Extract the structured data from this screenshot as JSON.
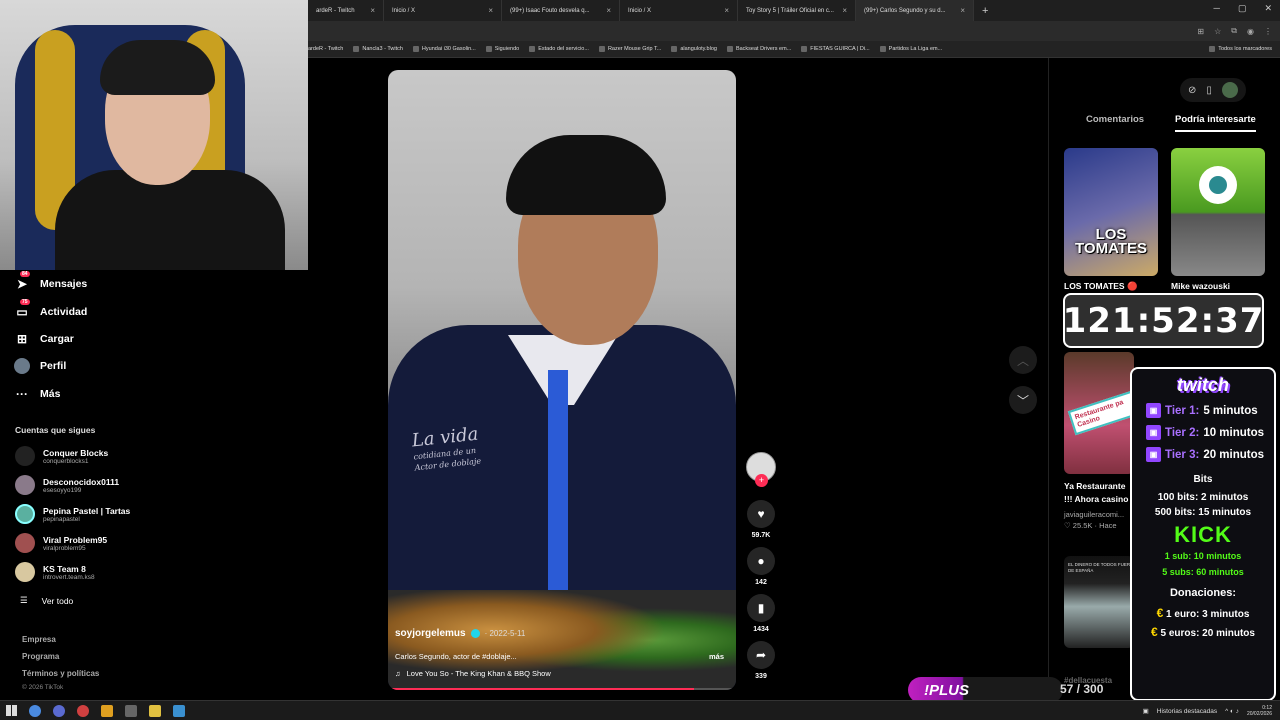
{
  "browser": {
    "tabs": [
      {
        "label": "ardeR - Twitch",
        "active": false
      },
      {
        "label": "Inicio / X",
        "active": false
      },
      {
        "label": "(99+) Isaac Fouto desvela q...",
        "active": false
      },
      {
        "label": "Inicio / X",
        "active": false
      },
      {
        "label": "Toy Story 5 | Tráiler Oficial en c...",
        "active": false
      },
      {
        "label": "(99+) Carlos Segundo y su d...",
        "active": true
      }
    ],
    "new_tab": "+",
    "bookmarks": [
      "ardeR - Twitch",
      "Nancla3 - Twitch",
      "Hyundai i30 Gasolin...",
      "Siguiendo",
      "Estado del servicio...",
      "Razer Mouse Grip T...",
      "alanguloty.blog",
      "Backseat Drivers em...",
      "FIESTAS GUIRCA | Di...",
      "Partidos La Liga em..."
    ],
    "all_bookmarks": "Todos los marcadores"
  },
  "nav": {
    "items": [
      {
        "label": "Mensajes",
        "icon": "send-icon",
        "badge": "84"
      },
      {
        "label": "Actividad",
        "icon": "inbox-icon",
        "badge": "75"
      },
      {
        "label": "Cargar",
        "icon": "upload-icon",
        "badge": ""
      },
      {
        "label": "Perfil",
        "icon": "profile-icon",
        "badge": ""
      },
      {
        "label": "Más",
        "icon": "more-icon",
        "badge": ""
      }
    ],
    "following_title": "Cuentas que sigues",
    "following": [
      {
        "name": "Conquer Blocks",
        "handle": "conquerblocks1"
      },
      {
        "name": "Desconocidox0111",
        "handle": "esesoyyo199"
      },
      {
        "name": "Pepina Pastel | Tartas",
        "handle": "pepinapastel"
      },
      {
        "name": "Viral Problem95",
        "handle": "viralproblem95"
      },
      {
        "name": "KS Team 8",
        "handle": "introvert.team.ks8"
      }
    ],
    "see_all": "Ver todo",
    "footer": [
      "Empresa",
      "Programa",
      "Términos y políticas"
    ],
    "copyright": "© 2026 TikTok"
  },
  "video": {
    "author": "soyjorgelemus",
    "date": "· 2022-5-11",
    "caption": "Carlos Segundo, actor de #doblaje...",
    "more": "más",
    "music": "Love You So - The King Khan & BBQ Show",
    "print_line1": "La vida",
    "print_line2": "cotidiana de un",
    "print_line3": "Actor de doblaje",
    "progress": 0.88
  },
  "actions": {
    "likes": "59.7K",
    "comments": "142",
    "saves": "1434",
    "shares": "339"
  },
  "right": {
    "tab_comments": "Comentarios",
    "tab_interest": "Podría interesarte",
    "thumb1_overlay": "LOS TOMATES",
    "thumb1_title": "LOS TOMATES 🔴",
    "thumb2_title": "Mike wazouski",
    "timer": "121:52:37",
    "thumb3_label": "Restaurante pa Casino",
    "thumb3_text1": "Ya Restaurante",
    "thumb3_text2": "!!! Ahora casino",
    "thumb3_author": "javiaguileracomi...",
    "thumb3_likes": "♡ 25.5K · Hace",
    "thumb4_header": "EL DINERO DE TODOS FUERA DE ESPAÑA",
    "thumb4_tags": "#dellacuesta"
  },
  "overlay": {
    "twitch_logo": "twitch",
    "tiers": [
      {
        "label": "Tier 1:",
        "value": "5 minutos"
      },
      {
        "label": "Tier 2:",
        "value": "10 minutos"
      },
      {
        "label": "Tier 3:",
        "value": "20 minutos"
      }
    ],
    "bits_title": "Bits",
    "bits": [
      "100 bits: 2 minutos",
      "500 bits: 15 minutos"
    ],
    "kick_logo": "KICK",
    "kick": [
      "1 sub: 10 minutos",
      "5 subs: 60 minutos"
    ],
    "donations_title": "Donaciones:",
    "donations": [
      "1 euro: 3 minutos",
      "5 euros: 20 minutos"
    ],
    "euro": "€"
  },
  "stream": {
    "plus": "!PLUS",
    "counter": "57 / 300"
  },
  "taskbar": {
    "highlights": "Historias destacadas",
    "time": "0:12",
    "date": "20/02/2026"
  },
  "colors": {
    "accent": "#fe2c55",
    "twitch": "#9146ff",
    "kick": "#53fc18",
    "verified": "#20d5ec"
  }
}
